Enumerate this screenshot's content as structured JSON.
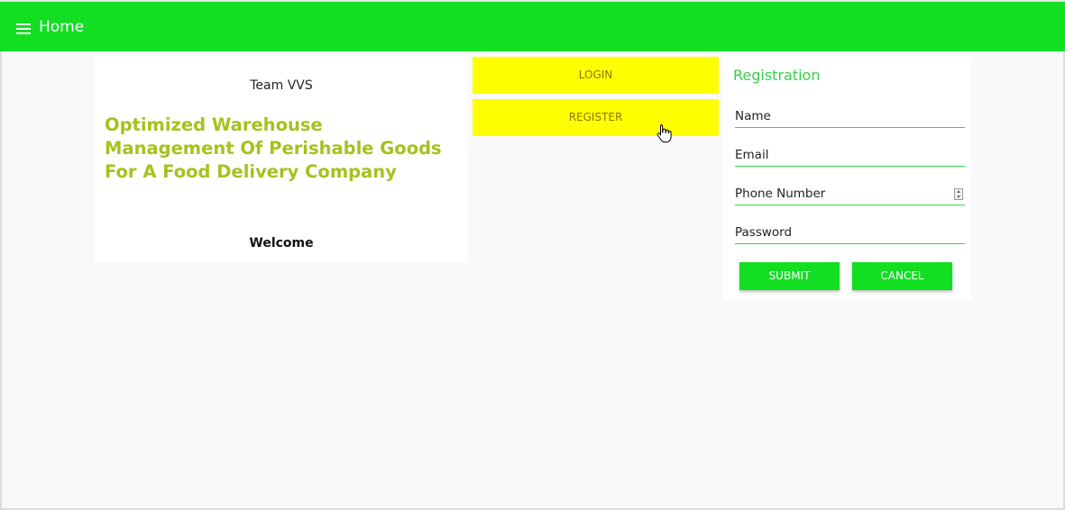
{
  "header": {
    "home_label": "Home",
    "menu_icon": "hamburger-menu-icon",
    "background": "#12de22"
  },
  "intro": {
    "team": "Team VVS",
    "project_title": "Optimized Warehouse Management Of Perishable Goods For A Food Delivery Company",
    "welcome": "Welcome",
    "title_color": "#a5c21d"
  },
  "nav": {
    "login_label": "LOGIN",
    "register_label": "REGISTER",
    "button_color": "#ffff00"
  },
  "registration": {
    "title": "Registration",
    "name_placeholder": "Name",
    "email_placeholder": "Email",
    "phone_placeholder": "Phone Number",
    "password_placeholder": "Password",
    "submit_label": "SUBMIT",
    "cancel_label": "CANCEL",
    "accent": "#35d14a"
  }
}
